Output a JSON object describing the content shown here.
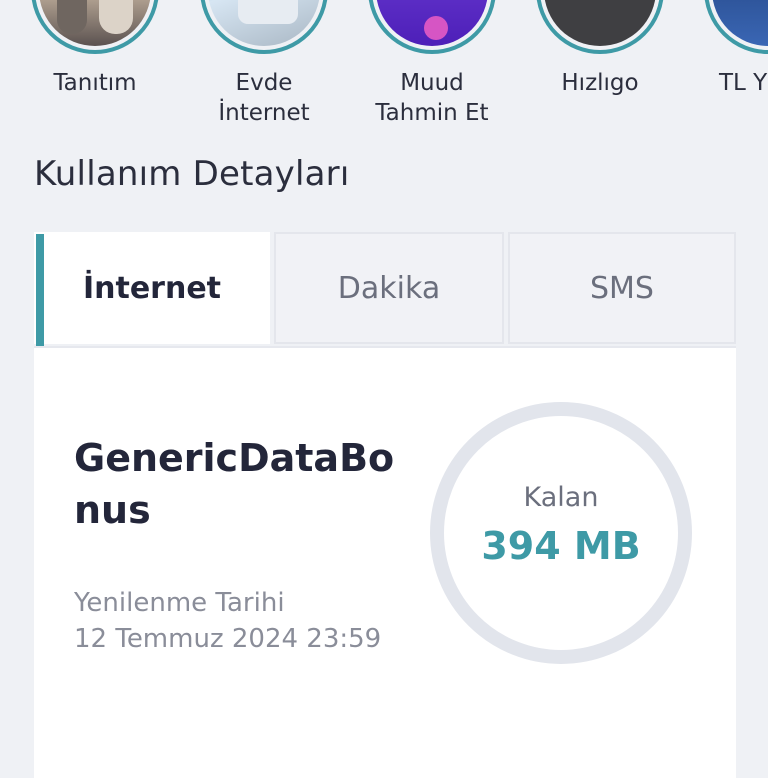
{
  "stories": [
    {
      "label": "Tanıtım",
      "thumb_icon": "people-photo"
    },
    {
      "label": "Evde\nİnternet",
      "thumb_icon": "home-internet-photo"
    },
    {
      "label": "Muud\nTahmin Et",
      "thumb_icon": "muud-logo"
    },
    {
      "label": "Hızlıgo",
      "thumb_icon": "hizligo-logo"
    },
    {
      "label": "TL Y",
      "thumb_icon": "tl-promo-photo"
    }
  ],
  "section_title": "Kullanım Detayları",
  "tabs": [
    {
      "label": "İnternet",
      "active": true
    },
    {
      "label": "Dakika",
      "active": false
    },
    {
      "label": "SMS",
      "active": false
    }
  ],
  "usage": {
    "package_name": "GenericDataBonus",
    "renewal_label": "Yenilenme Tarihi",
    "renewal_date": "12 Temmuz 2024 23:59",
    "remaining_label": "Kalan",
    "remaining_amount": "394 MB"
  },
  "colors": {
    "accent": "#3e9aa6",
    "background": "#eff1f5",
    "ring_track": "#e2e5ec"
  }
}
